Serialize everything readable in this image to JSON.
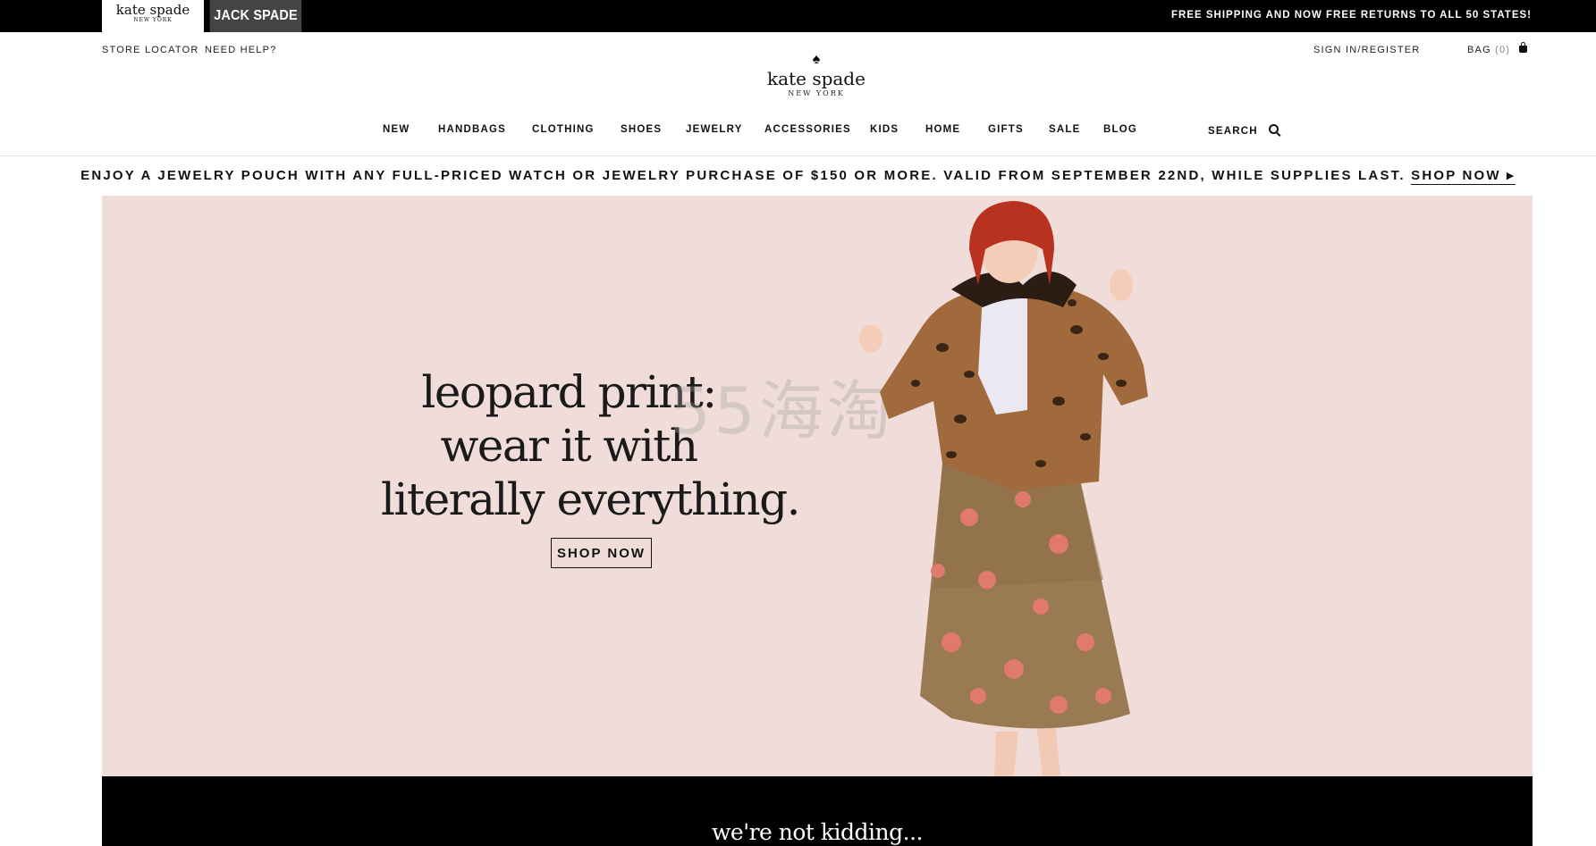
{
  "topbar": {
    "brand_primary": {
      "name": "kate spade",
      "sub": "NEW YORK"
    },
    "brand_secondary": "JACK SPADE",
    "promo": "FREE SHIPPING AND NOW FREE RETURNS TO ALL 50 STATES!"
  },
  "utility": {
    "store_locator": "STORE LOCATOR",
    "need_help": "NEED HELP?",
    "sign_in": "SIGN IN/REGISTER",
    "bag_label": "BAG",
    "bag_count": "(0)"
  },
  "logo": {
    "symbol": "♠",
    "name": "kate spade",
    "sub": "NEW YORK"
  },
  "nav": {
    "items": [
      "NEW",
      "HANDBAGS",
      "CLOTHING",
      "SHOES",
      "JEWELRY",
      "ACCESSORIES",
      "KIDS",
      "HOME",
      "GIFTS",
      "SALE",
      "BLOG"
    ],
    "search_label": "SEARCH"
  },
  "promo_strip": {
    "text": "ENJOY A JEWELRY POUCH WITH ANY FULL-PRICED WATCH OR JEWELRY PURCHASE OF $150 OR MORE. VALID FROM SEPTEMBER 22ND, WHILE SUPPLIES LAST.",
    "link": "SHOP NOW ▸"
  },
  "hero": {
    "headline_lines": [
      "leopard print:",
      "wear it with",
      "literally everything."
    ],
    "cta": "SHOP NOW",
    "watermark": "55海淘",
    "background": "#f0ddd9"
  },
  "band": {
    "text": "we're not kidding..."
  },
  "colors": {
    "topbar_bg": "#000000",
    "brand_secondary_bg": "#444444",
    "hero_bg": "#f0ddd9",
    "band_bg": "#000000"
  }
}
